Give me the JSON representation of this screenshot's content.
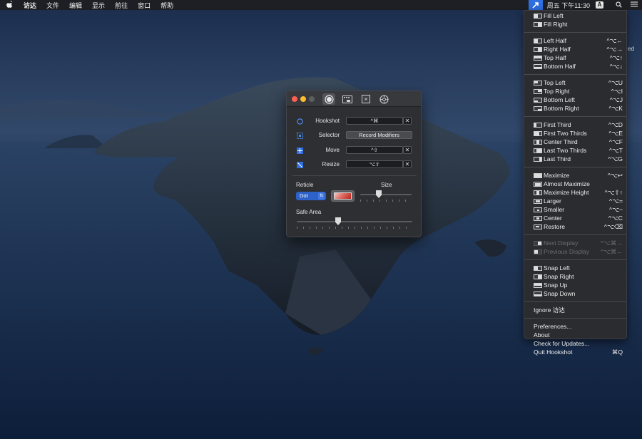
{
  "menubar": {
    "apple": "",
    "items": [
      "访达",
      "文件",
      "编辑",
      "显示",
      "前往",
      "窗口",
      "帮助"
    ],
    "clock": "周五 下午11:30",
    "input_method": "A"
  },
  "desktop": {
    "partial_text": "ed"
  },
  "menu": {
    "groups": [
      [
        {
          "label": "Fill Left",
          "shortcut": ""
        },
        {
          "label": "Fill Right",
          "shortcut": ""
        }
      ],
      [
        {
          "label": "Left Half",
          "shortcut": "^⌥←"
        },
        {
          "label": "Right Half",
          "shortcut": "^⌥→"
        },
        {
          "label": "Top Half",
          "shortcut": "^⌥↑"
        },
        {
          "label": "Bottom Half",
          "shortcut": "^⌥↓"
        }
      ],
      [
        {
          "label": "Top Left",
          "shortcut": "^⌥U"
        },
        {
          "label": "Top Right",
          "shortcut": "^⌥I"
        },
        {
          "label": "Bottom Left",
          "shortcut": "^⌥J"
        },
        {
          "label": "Bottom Right",
          "shortcut": "^⌥K"
        }
      ],
      [
        {
          "label": "First Third",
          "shortcut": "^⌥D"
        },
        {
          "label": "First Two Thirds",
          "shortcut": "^⌥E"
        },
        {
          "label": "Center Third",
          "shortcut": "^⌥F"
        },
        {
          "label": "Last Two Thirds",
          "shortcut": "^⌥T"
        },
        {
          "label": "Last Third",
          "shortcut": "^⌥G"
        }
      ],
      [
        {
          "label": "Maximize",
          "shortcut": "^⌥↩"
        },
        {
          "label": "Almost Maximize",
          "shortcut": ""
        },
        {
          "label": "Maximize Height",
          "shortcut": "^⌥⇧↑"
        },
        {
          "label": "Larger",
          "shortcut": "^⌥="
        },
        {
          "label": "Smaller",
          "shortcut": "^⌥−"
        },
        {
          "label": "Center",
          "shortcut": "^⌥C"
        },
        {
          "label": "Restore",
          "shortcut": "^⌥⌫"
        }
      ],
      [
        {
          "label": "Next Display",
          "shortcut": "^⌥⌘→",
          "disabled": true
        },
        {
          "label": "Previous Display",
          "shortcut": "^⌥⌘←",
          "disabled": true
        }
      ],
      [
        {
          "label": "Snap Left",
          "shortcut": ""
        },
        {
          "label": "Snap Right",
          "shortcut": ""
        },
        {
          "label": "Snap Up",
          "shortcut": ""
        },
        {
          "label": "Snap Down",
          "shortcut": ""
        }
      ]
    ],
    "ignore": "Ignore 访达",
    "footer": [
      {
        "label": "Preferences...",
        "shortcut": ""
      },
      {
        "label": "About",
        "shortcut": ""
      },
      {
        "label": "Check for Updates...",
        "shortcut": ""
      },
      {
        "label": "Quit Hookshot",
        "shortcut": "⌘Q"
      }
    ]
  },
  "prefs": {
    "rows": {
      "hookshot": {
        "label": "Hookshot",
        "value": "^⌘"
      },
      "selector": {
        "label": "Selector",
        "value": "Record Modifiers"
      },
      "move": {
        "label": "Move",
        "value": "^⇧"
      },
      "resize": {
        "label": "Resize",
        "value": "⌥⇧"
      }
    },
    "clear_glyph": "✕",
    "reticle_label": "Reticle",
    "reticle_value": "Dot",
    "size_label": "Size",
    "safe_area_label": "Safe Area",
    "size_level": 0.35,
    "safe_area_level": 0.35,
    "reticle_color": "#d23b30"
  }
}
